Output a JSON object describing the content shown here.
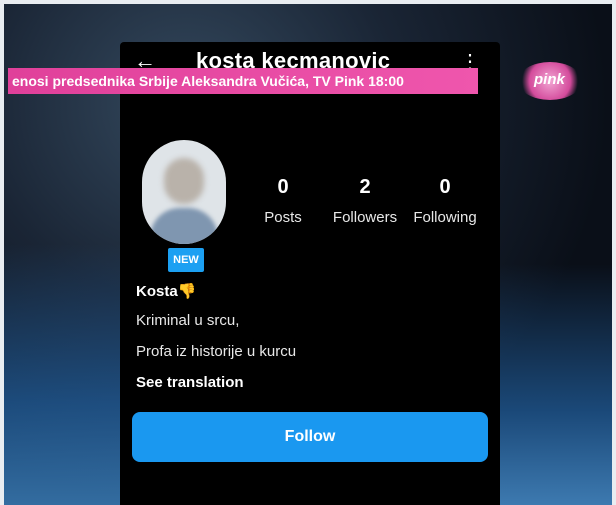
{
  "header": {
    "username": "kosta kecmanovic",
    "back_icon": "arrow-left-icon",
    "more_icon": "more-vertical-icon"
  },
  "ticker": {
    "text": "enosi predsednika Srbije Aleksandra Vučića, TV Pink 18:00"
  },
  "tv_logo": {
    "text": "pink",
    "color": "#d44b9c"
  },
  "profile": {
    "badge": "NEW",
    "stats": [
      {
        "value": "0",
        "label": "Posts"
      },
      {
        "value": "2",
        "label": "Followers"
      },
      {
        "value": "0",
        "label": "Following"
      }
    ],
    "name": "Kosta",
    "name_emoji": "👎",
    "bio_lines": [
      "Kriminal u srcu,",
      "Profa iz historije u kurcu"
    ],
    "see_translation": "See translation",
    "follow_label": "Follow",
    "accent_color": "#1a98f0"
  }
}
